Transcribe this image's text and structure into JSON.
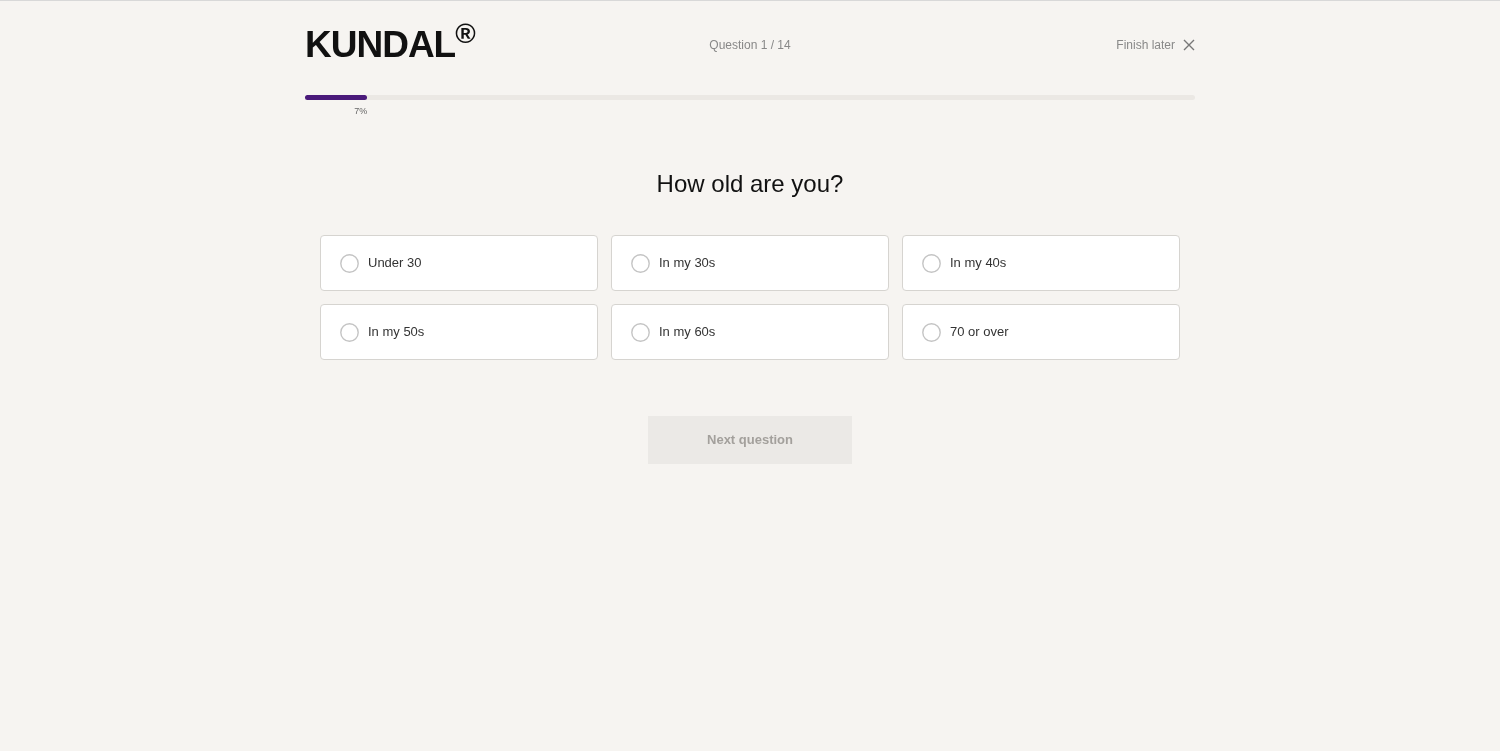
{
  "header": {
    "logo": "KUNDAL$^{®}$",
    "question_counter": "Question 1 / 14",
    "finish_later": "Finish later"
  },
  "progress": {
    "level": 0.07,
    "label": "7%"
  },
  "question": "How old are you?",
  "options": [
    {
      "label": "Under 30",
      "selected": false
    },
    {
      "label": "In my 30s",
      "selected": false
    },
    {
      "label": "In my 40s",
      "selected": false
    },
    {
      "label": "In my 50s",
      "selected": false
    },
    {
      "label": "In my 60s",
      "selected": false
    },
    {
      "label": "70 or over",
      "selected": false
    }
  ],
  "next_button": {
    "label": "Next question",
    "disabled": true
  }
}
